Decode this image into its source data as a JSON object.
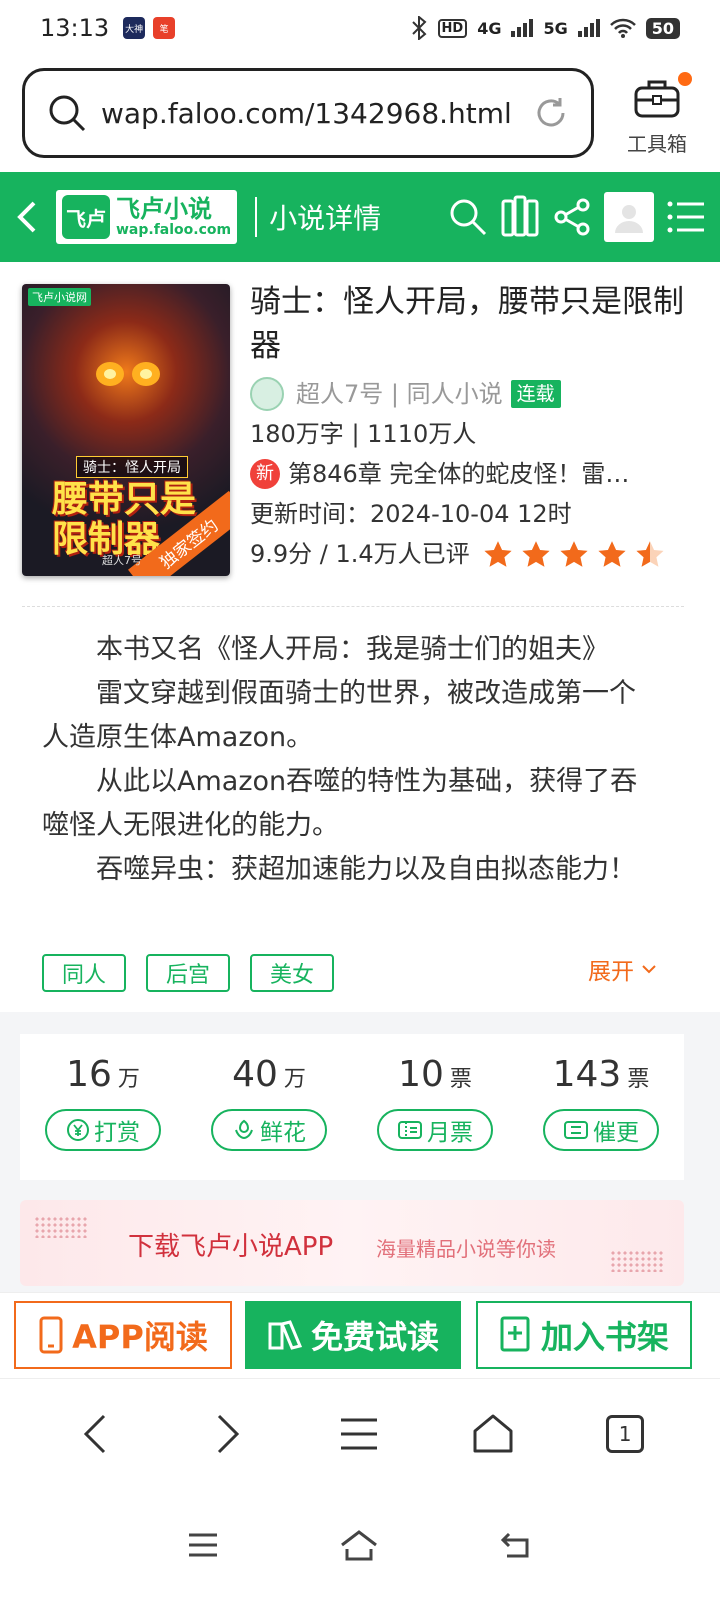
{
  "status_bar": {
    "time": "13:13",
    "app_icon_1": "大神",
    "app_icon_2": "笔",
    "hd": "HD",
    "net1": "4G",
    "net2": "5G",
    "battery": "50"
  },
  "browser": {
    "url": "wap.faloo.com/1342968.html",
    "toolbox_label": "工具箱"
  },
  "header": {
    "logo_mark": "飞卢",
    "logo_cn": "飞卢小说",
    "logo_url": "wap.faloo.com",
    "title": "小说详情"
  },
  "book": {
    "cover": {
      "site": "飞卢小说网",
      "subtitle": "骑士：怪人开局",
      "big_line1": "腰带只是",
      "big_line2": "限制器",
      "ribbon": "独家签约",
      "author_small": "超人7号"
    },
    "title": "骑士：怪人开局，腰带只是限制器",
    "author": "超人7号",
    "category": "同人小说",
    "status": "连载",
    "words": "180万字",
    "readers": "1110万人",
    "new_label": "新",
    "latest_chapter": "第846章 完全体的蛇皮怪！雷…",
    "update_label": "更新时间：",
    "update_time": "2024-10-04 12时",
    "score": "9.9分",
    "ratings": "1.4万人已评",
    "stars": 4.5
  },
  "intro": {
    "p1": "本书又名《怪人开局：我是骑士们的姐夫》",
    "p2": "雷文穿越到假面骑士的世界，被改造成第一个人造原生体Amazon。",
    "p3": "从此以Amazon吞噬的特性为基础，获得了吞噬怪人无限进化的能力。",
    "p4": "吞噬异虫：获超加速能力以及自由拟态能力！"
  },
  "tags": [
    "同人",
    "后宫",
    "美女"
  ],
  "expand_label": "展开",
  "stats": [
    {
      "num": "16",
      "unit": "万",
      "btn": "打赏",
      "icon": "yen-icon"
    },
    {
      "num": "40",
      "unit": "万",
      "btn": "鲜花",
      "icon": "flower-icon"
    },
    {
      "num": "10",
      "unit": "票",
      "btn": "月票",
      "icon": "ticket-icon"
    },
    {
      "num": "143",
      "unit": "票",
      "btn": "催更",
      "icon": "urge-icon"
    }
  ],
  "banner": {
    "main": "下载飞卢小说APP",
    "sub": "海量精品小说等你读"
  },
  "actions": {
    "app_read": "APP阅读",
    "free_read": "免费试读",
    "add_shelf": "加入书架"
  },
  "tab_count": "1",
  "colors": {
    "brand_green": "#17b35e",
    "accent_orange": "#f26a1b",
    "banner_red": "#d1313d"
  }
}
